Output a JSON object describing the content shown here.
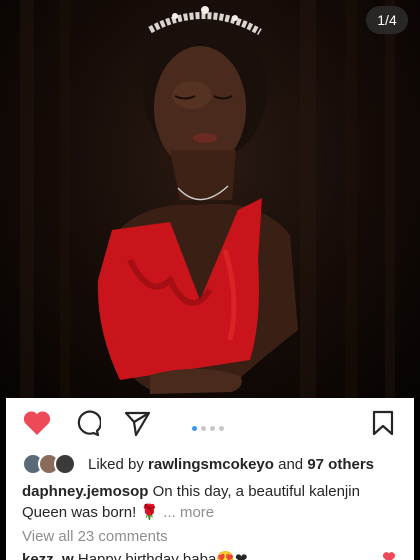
{
  "post": {
    "image_counter": "1/4",
    "image_alt": "portrait of a young woman in a red satin dress wearing a pearl tiara against a dark curtain"
  },
  "actions": {
    "like_icon": "heart-filled-icon",
    "comment_icon": "comment-icon",
    "share_icon": "send-icon",
    "save_icon": "bookmark-icon",
    "like_color": "#ed4956"
  },
  "carousel": {
    "total": 4,
    "active": 1
  },
  "likes": {
    "prefix": "Liked by",
    "user": "rawlingsmcokeyo",
    "connector": "and",
    "others": "97 others"
  },
  "caption": {
    "username": "daphney.jemosop",
    "text": "On this day, a beautiful kalenjin Queen was born!",
    "emoji": "🌹",
    "more": "... more"
  },
  "comments": {
    "view_all": "View all 23 comments",
    "first": {
      "username": "kezz_w",
      "text": "Happy birthday baba😍❤"
    }
  },
  "colors": {
    "accent_blue": "#3897f0",
    "text": "#262626",
    "muted": "#8e8e8e"
  }
}
